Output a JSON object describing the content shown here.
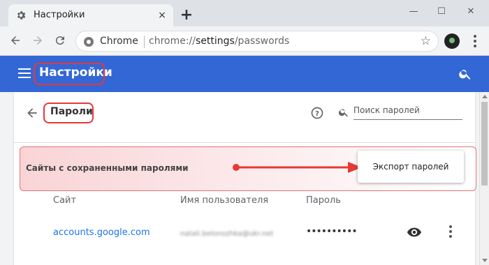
{
  "tab": {
    "title": "Настройки",
    "close_icon": "×",
    "new_tab_icon": "+"
  },
  "window_controls": {
    "minimize": "—",
    "maximize": "☐",
    "close": "✕"
  },
  "omnibox": {
    "site": "Chrome",
    "url_prefix": "chrome://",
    "url_host": "settings",
    "url_path": "/passwords",
    "star_icon": "☆"
  },
  "header": {
    "title": "Настройки"
  },
  "passwords": {
    "title": "Пароли",
    "search_placeholder": "Поиск паролей",
    "saved_label": "Сайты с сохраненными паролями",
    "export_label": "Экспорт паролей",
    "columns": {
      "site": "Сайт",
      "username": "Имя пользователя",
      "password": "Пароль"
    },
    "rows": [
      {
        "site": "accounts.google.com",
        "username": "natali.belonozhka@ukr.net",
        "password": "••••••••••"
      }
    ]
  },
  "colors": {
    "header_bg": "#3367d6",
    "highlight": "#e53935",
    "link": "#1a73e8"
  }
}
